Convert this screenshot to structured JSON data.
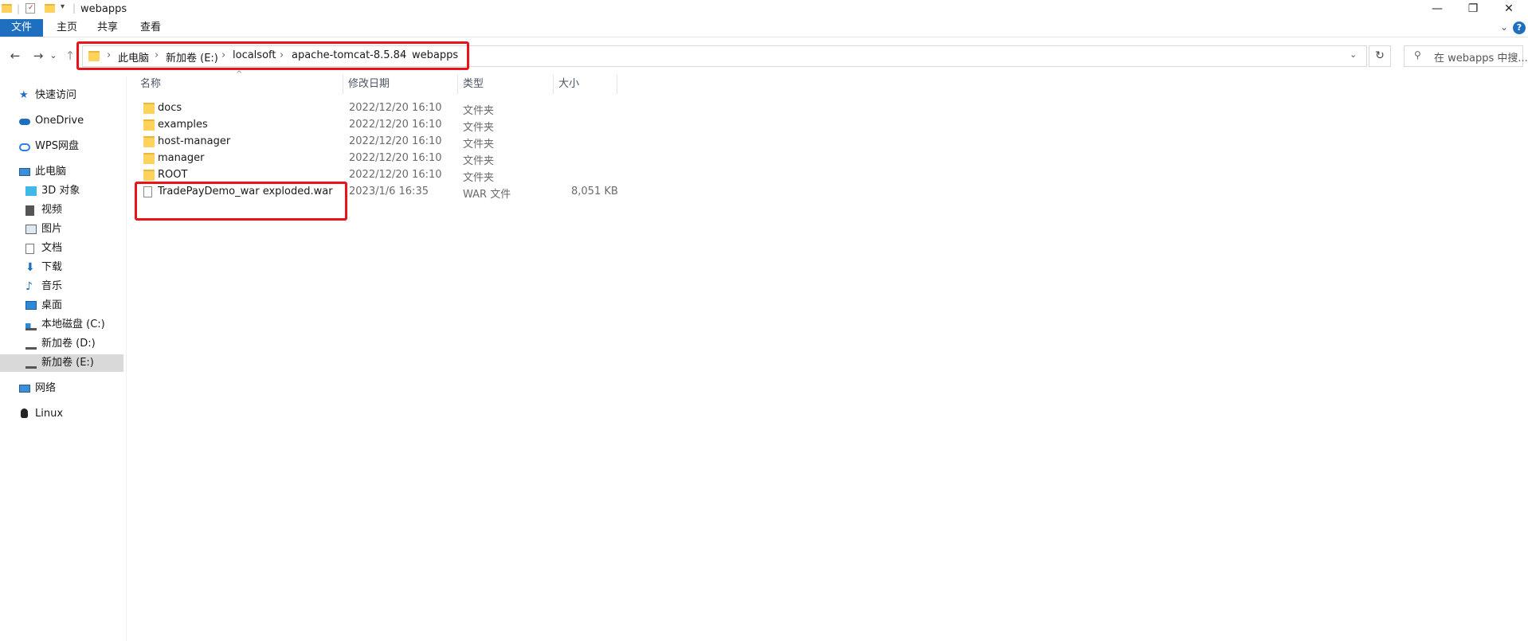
{
  "window": {
    "title": "webapps",
    "controls": {
      "minimize": "—",
      "maximize": "❐",
      "close": "✕"
    }
  },
  "ribbon": {
    "tabs": [
      "文件",
      "主页",
      "共享",
      "查看"
    ],
    "expand": "⌄",
    "help": "?"
  },
  "nav": {
    "back": "←",
    "forward": "→",
    "recent": "⌄",
    "up": "↑",
    "refresh": "↻"
  },
  "address": {
    "crumbs": [
      "此电脑",
      "新加卷 (E:)",
      "localsoft",
      "apache-tomcat-8.5.84",
      "webapps"
    ],
    "separator": "›",
    "dropdown": "⌄"
  },
  "search": {
    "placeholder": "在 webapps 中搜..."
  },
  "sidebar": {
    "items": [
      {
        "label": "快速访问",
        "icon": "star-icon"
      },
      {
        "label": "OneDrive",
        "icon": "cloud-icon"
      },
      {
        "label": "WPS网盘",
        "icon": "wps-cloud-icon"
      },
      {
        "label": "此电脑",
        "icon": "computer-icon"
      },
      {
        "label": "3D 对象",
        "icon": "cube-icon"
      },
      {
        "label": "视频",
        "icon": "video-icon"
      },
      {
        "label": "图片",
        "icon": "pictures-icon"
      },
      {
        "label": "文档",
        "icon": "documents-icon"
      },
      {
        "label": "下载",
        "icon": "download-icon"
      },
      {
        "label": "音乐",
        "icon": "music-icon"
      },
      {
        "label": "桌面",
        "icon": "desktop-icon"
      },
      {
        "label": "本地磁盘 (C:)",
        "icon": "system-drive-icon"
      },
      {
        "label": "新加卷 (D:)",
        "icon": "drive-icon"
      },
      {
        "label": "新加卷 (E:)",
        "icon": "drive-icon",
        "selected": true
      },
      {
        "label": "网络",
        "icon": "network-icon"
      },
      {
        "label": "Linux",
        "icon": "linux-icon"
      }
    ]
  },
  "columns": {
    "name": "名称",
    "modified": "修改日期",
    "type": "类型",
    "size": "大小",
    "sort_indicator": "^"
  },
  "files": [
    {
      "name": "docs",
      "modified": "2022/12/20 16:10",
      "type": "文件夹",
      "size": "",
      "icon": "folder-icon"
    },
    {
      "name": "examples",
      "modified": "2022/12/20 16:10",
      "type": "文件夹",
      "size": "",
      "icon": "folder-icon"
    },
    {
      "name": "host-manager",
      "modified": "2022/12/20 16:10",
      "type": "文件夹",
      "size": "",
      "icon": "folder-icon"
    },
    {
      "name": "manager",
      "modified": "2022/12/20 16:10",
      "type": "文件夹",
      "size": "",
      "icon": "folder-icon"
    },
    {
      "name": "ROOT",
      "modified": "2022/12/20 16:10",
      "type": "文件夹",
      "size": "",
      "icon": "folder-icon"
    },
    {
      "name": "TradePayDemo_war exploded.war",
      "modified": "2023/1/6 16:35",
      "type": "WAR 文件",
      "size": "8,051 KB",
      "icon": "file-icon"
    }
  ],
  "colors": {
    "accent": "#1f6fc0",
    "highlight": "#e8141a",
    "folder": "#ffd35b",
    "selected_bg": "#d9d9d9"
  }
}
